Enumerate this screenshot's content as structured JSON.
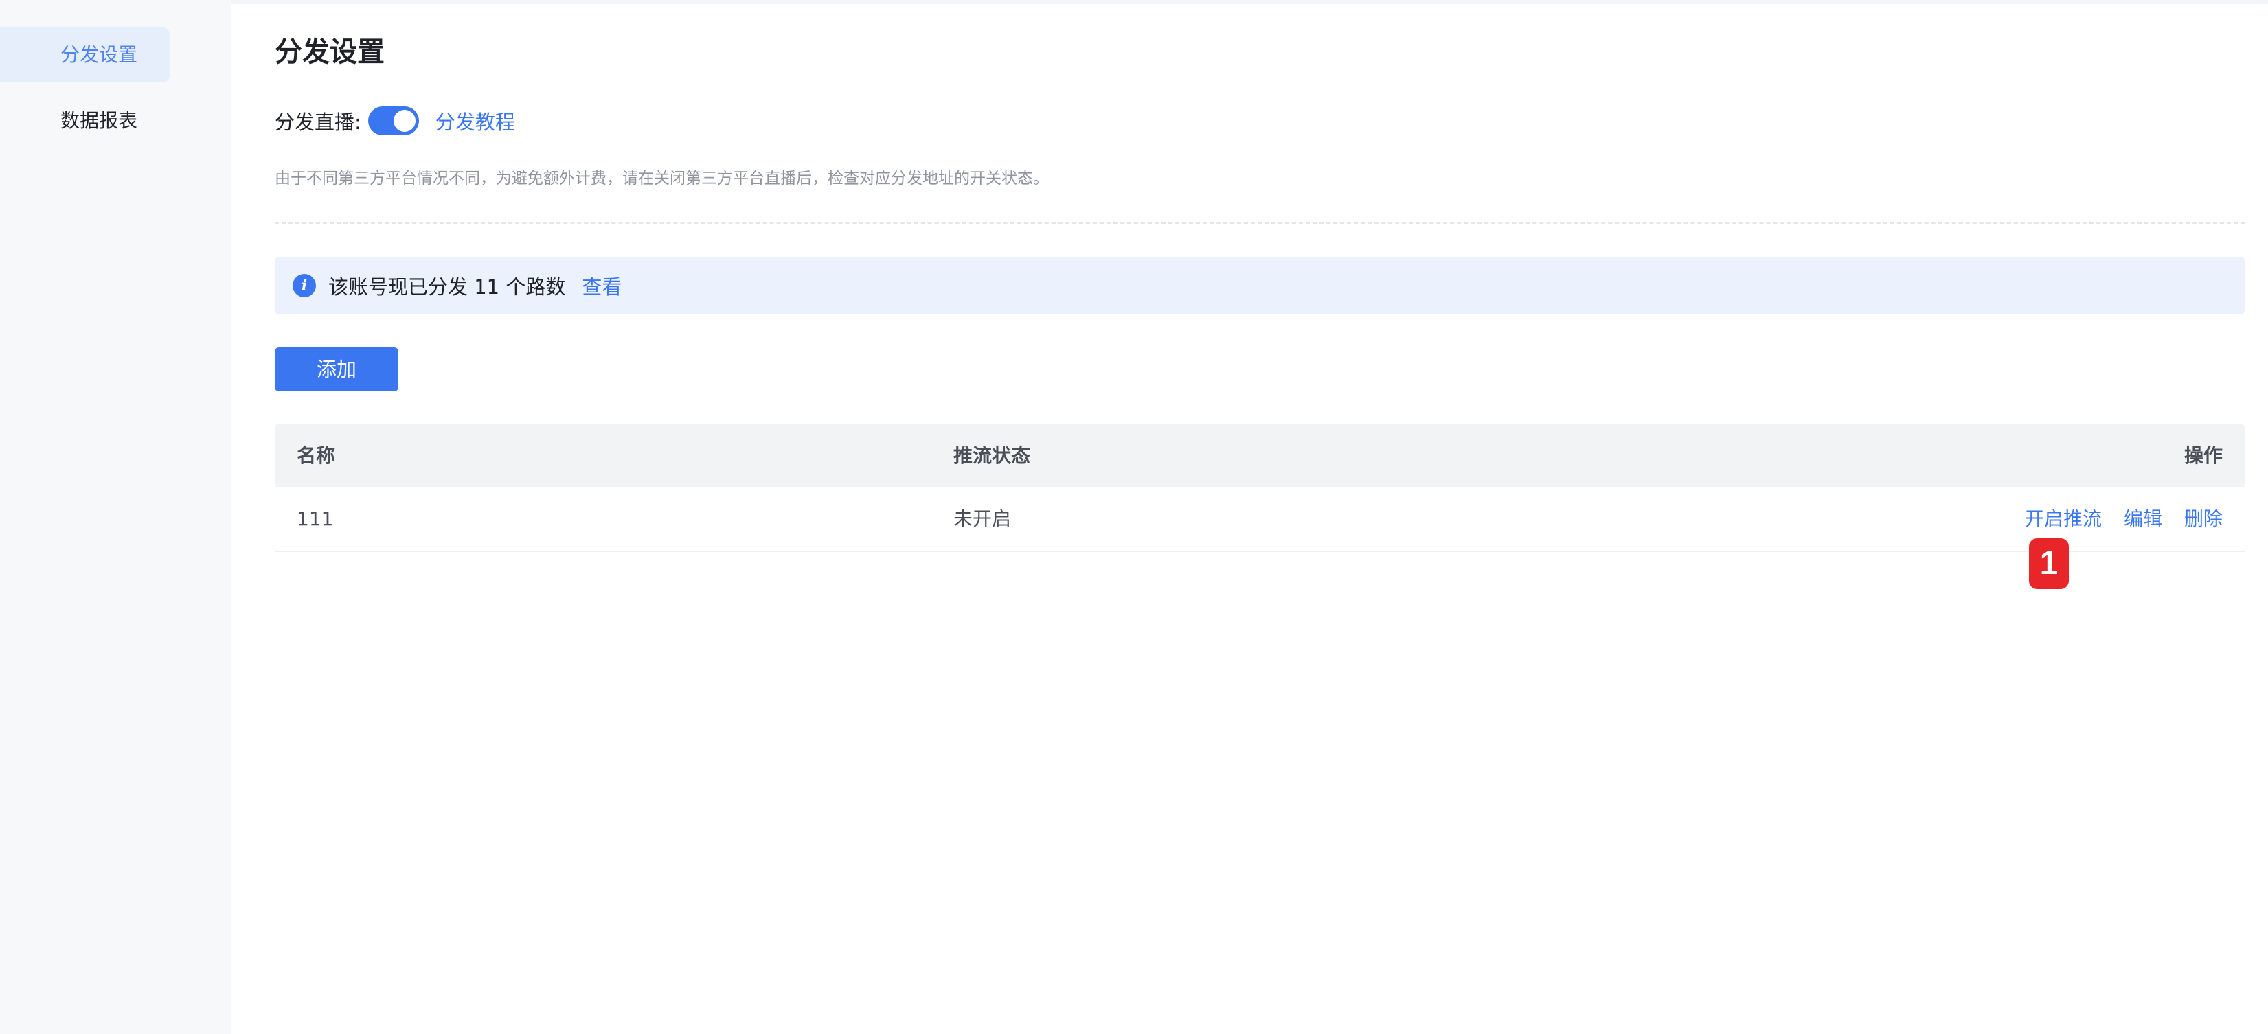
{
  "sidebar": {
    "items": [
      {
        "label": "分发设置",
        "active": true
      },
      {
        "label": "数据报表",
        "active": false
      }
    ]
  },
  "header": {
    "title": "分发设置"
  },
  "distribution": {
    "switch_label": "分发直播:",
    "switch_on": true,
    "tutorial_link": "分发教程",
    "hint": "由于不同第三方平台情况不同，为避免额外计费，请在关闭第三方平台直播后，检查对应分发地址的开关状态。"
  },
  "notice": {
    "icon": "info-icon",
    "text": "该账号现已分发 11 个路数",
    "link": "查看"
  },
  "toolbar": {
    "add_label": "添加"
  },
  "table": {
    "columns": [
      "名称",
      "推流状态",
      "操作"
    ],
    "rows": [
      {
        "name": "111",
        "status": "未开启",
        "actions": [
          "开启推流",
          "编辑",
          "删除"
        ]
      }
    ]
  },
  "annotation": {
    "badge_label": "1"
  },
  "colors": {
    "accent": "#3a76f0",
    "sidebar_bg": "#f6f8fa",
    "sidebar_active_bg": "#e6eefc",
    "notice_bg": "#ebf1fd",
    "badge": "#e8262a"
  }
}
